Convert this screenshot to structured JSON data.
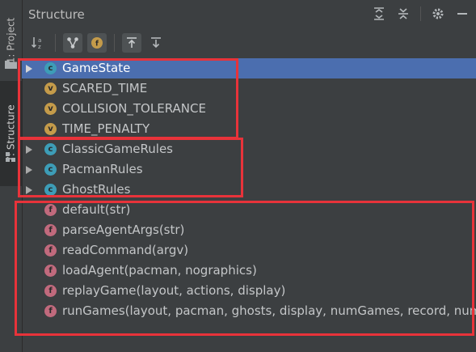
{
  "sidebar": {
    "project_tab": "1: Project",
    "structure_tab": "7: Structure"
  },
  "panel": {
    "title": "Structure"
  },
  "tree": {
    "groups": [
      {
        "items": [
          {
            "kind": "C",
            "label": "GameState",
            "expandable": true,
            "selected": true
          },
          {
            "kind": "V",
            "label": "SCARED_TIME",
            "expandable": false
          },
          {
            "kind": "V",
            "label": "COLLISION_TOLERANCE",
            "expandable": false
          },
          {
            "kind": "V",
            "label": "TIME_PENALTY",
            "expandable": false
          }
        ]
      },
      {
        "items": [
          {
            "kind": "C",
            "label": "ClassicGameRules",
            "expandable": true
          },
          {
            "kind": "C",
            "label": "PacmanRules",
            "expandable": true
          },
          {
            "kind": "C",
            "label": "GhostRules",
            "expandable": true
          }
        ]
      },
      {
        "items": [
          {
            "kind": "F",
            "label": "default(str)",
            "expandable": false
          },
          {
            "kind": "F",
            "label": "parseAgentArgs(str)",
            "expandable": false
          },
          {
            "kind": "F",
            "label": "readCommand(argv)",
            "expandable": false
          },
          {
            "kind": "F",
            "label": "loadAgent(pacman, nographics)",
            "expandable": false
          },
          {
            "kind": "F",
            "label": "replayGame(layout, actions, display)",
            "expandable": false
          },
          {
            "kind": "F",
            "label": "runGames(layout, pacman, ghosts, display, numGames, record, num",
            "expandable": false
          }
        ]
      }
    ]
  },
  "colors": {
    "selection": "#4b6eaf",
    "class_badge": "#3d9db7",
    "variable_badge": "#c49b4a",
    "function_badge": "#c16a7d",
    "highlight_box": "#e8333a"
  }
}
